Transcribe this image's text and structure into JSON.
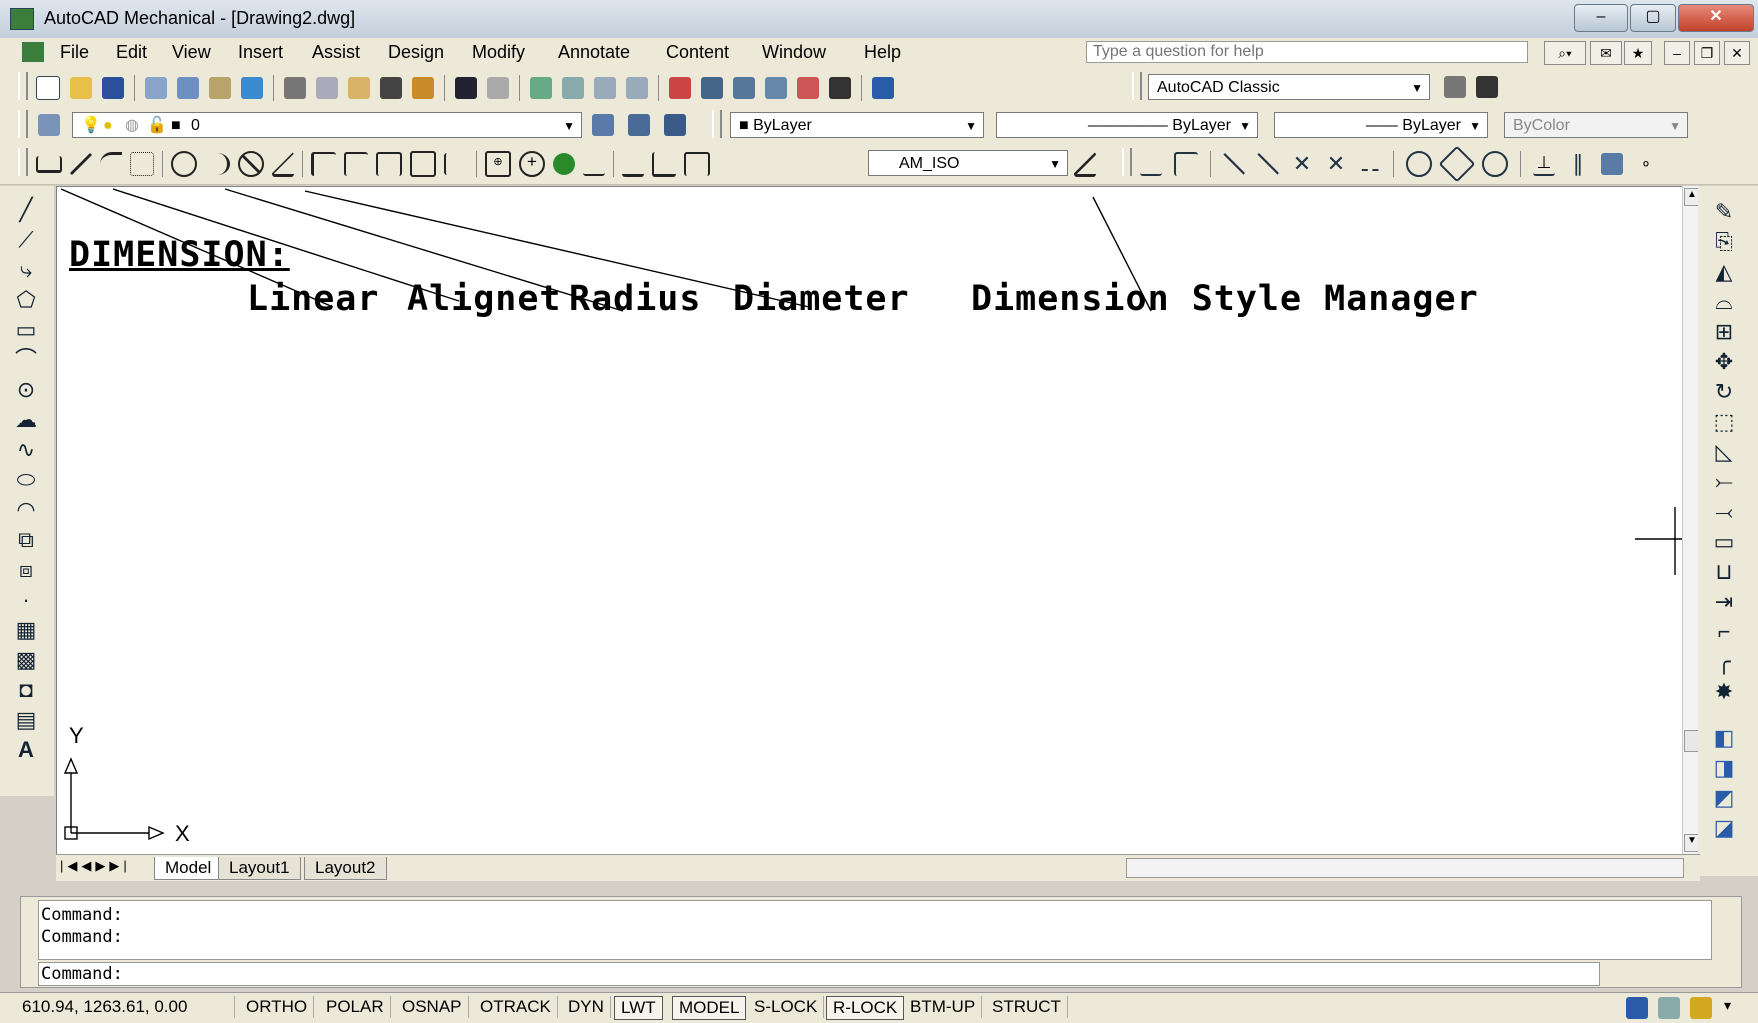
{
  "window": {
    "title": "AutoCAD Mechanical - [Drawing2.dwg]",
    "min": "–",
    "max": "▢",
    "close": "✕"
  },
  "menu": {
    "items": [
      "File",
      "Edit",
      "View",
      "Insert",
      "Assist",
      "Design",
      "Modify",
      "Annotate",
      "Content",
      "Window",
      "Help"
    ],
    "help_placeholder": "Type a question for help"
  },
  "toolbar_standard": {
    "workspace": "AutoCAD Classic"
  },
  "toolbar_layers": {
    "layer": "0",
    "color": "ByLayer",
    "linetype": "ByLayer",
    "lineweight": "ByLayer",
    "plotstyle": "ByColor"
  },
  "toolbar_dimension": {
    "dimstyle": "AM_ISO"
  },
  "drawing": {
    "heading": "DIMENSION:",
    "labels": {
      "linear": "Linear",
      "aligned": "Alignet",
      "radius": "Radius",
      "diameter": "Diameter",
      "dimstyle": "Dimension Style Manager"
    },
    "ucs_y": "Y",
    "ucs_x": "X"
  },
  "tabs": [
    "Model",
    "Layout1",
    "Layout2"
  ],
  "command": {
    "line1": "Command:",
    "line2": "Command:",
    "input": "Command:"
  },
  "status": {
    "coords": "610.94, 1263.61, 0.00",
    "toggles": [
      "ORTHO",
      "POLAR",
      "OSNAP",
      "OTRACK",
      "DYN",
      "LWT",
      "MODEL",
      "S-LOCK",
      "R-LOCK",
      "BTM-UP",
      "STRUCT"
    ]
  }
}
